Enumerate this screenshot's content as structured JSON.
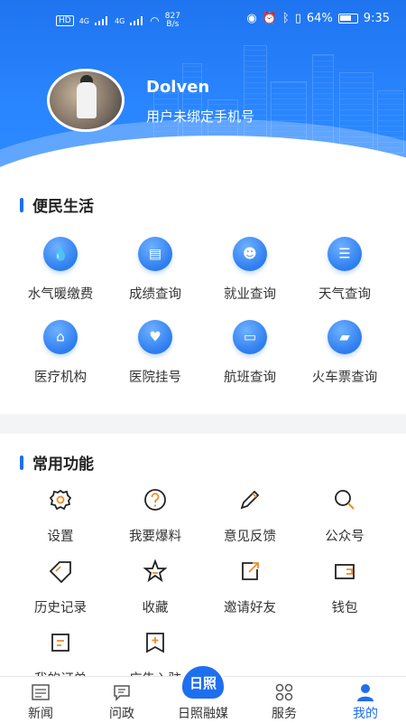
{
  "status_bar": {
    "left_text": "HD",
    "net1": "4G",
    "net2": "4G",
    "speed_value": "827",
    "speed_unit": "B/s",
    "battery": "64%",
    "time": "9:35"
  },
  "profile": {
    "username": "Dolven",
    "phone_status": "用户未绑定手机号"
  },
  "convenience": {
    "title": "便民生活",
    "items": [
      {
        "label": "水气暖缴费",
        "icon": "water-drop-icon"
      },
      {
        "label": "成绩查询",
        "icon": "clipboard-icon"
      },
      {
        "label": "就业查询",
        "icon": "person-card-icon"
      },
      {
        "label": "天气查询",
        "icon": "database-icon"
      },
      {
        "label": "医疗机构",
        "icon": "building-icon"
      },
      {
        "label": "医院挂号",
        "icon": "heart-hand-icon"
      },
      {
        "label": "航班查询",
        "icon": "bus-icon"
      },
      {
        "label": "火车票查询",
        "icon": "ticket-icon"
      }
    ]
  },
  "common": {
    "title": "常用功能",
    "items": [
      {
        "label": "设置",
        "icon": "gear-icon"
      },
      {
        "label": "我要爆料",
        "icon": "question-icon"
      },
      {
        "label": "意见反馈",
        "icon": "pencil-icon"
      },
      {
        "label": "公众号",
        "icon": "search-icon"
      },
      {
        "label": "历史记录",
        "icon": "tag-icon"
      },
      {
        "label": "收藏",
        "icon": "star-icon"
      },
      {
        "label": "邀请好友",
        "icon": "share-icon"
      },
      {
        "label": "钱包",
        "icon": "wallet-icon"
      },
      {
        "label": "我的订单",
        "icon": "order-icon"
      },
      {
        "label": "广告入驻",
        "icon": "bookmark-plus-icon"
      }
    ]
  },
  "bottom_nav": {
    "items": [
      {
        "label": "新闻",
        "icon": "news-icon"
      },
      {
        "label": "问政",
        "icon": "chat-icon"
      },
      {
        "label": "日照融媒",
        "icon": "rizhao-badge"
      },
      {
        "label": "服务",
        "icon": "grid-icon"
      },
      {
        "label": "我的",
        "icon": "user-icon"
      }
    ],
    "center_badge": "日照",
    "active": "我的"
  },
  "colors": {
    "accent": "#1e6ff0",
    "icon_orange": "#f08a2a"
  }
}
